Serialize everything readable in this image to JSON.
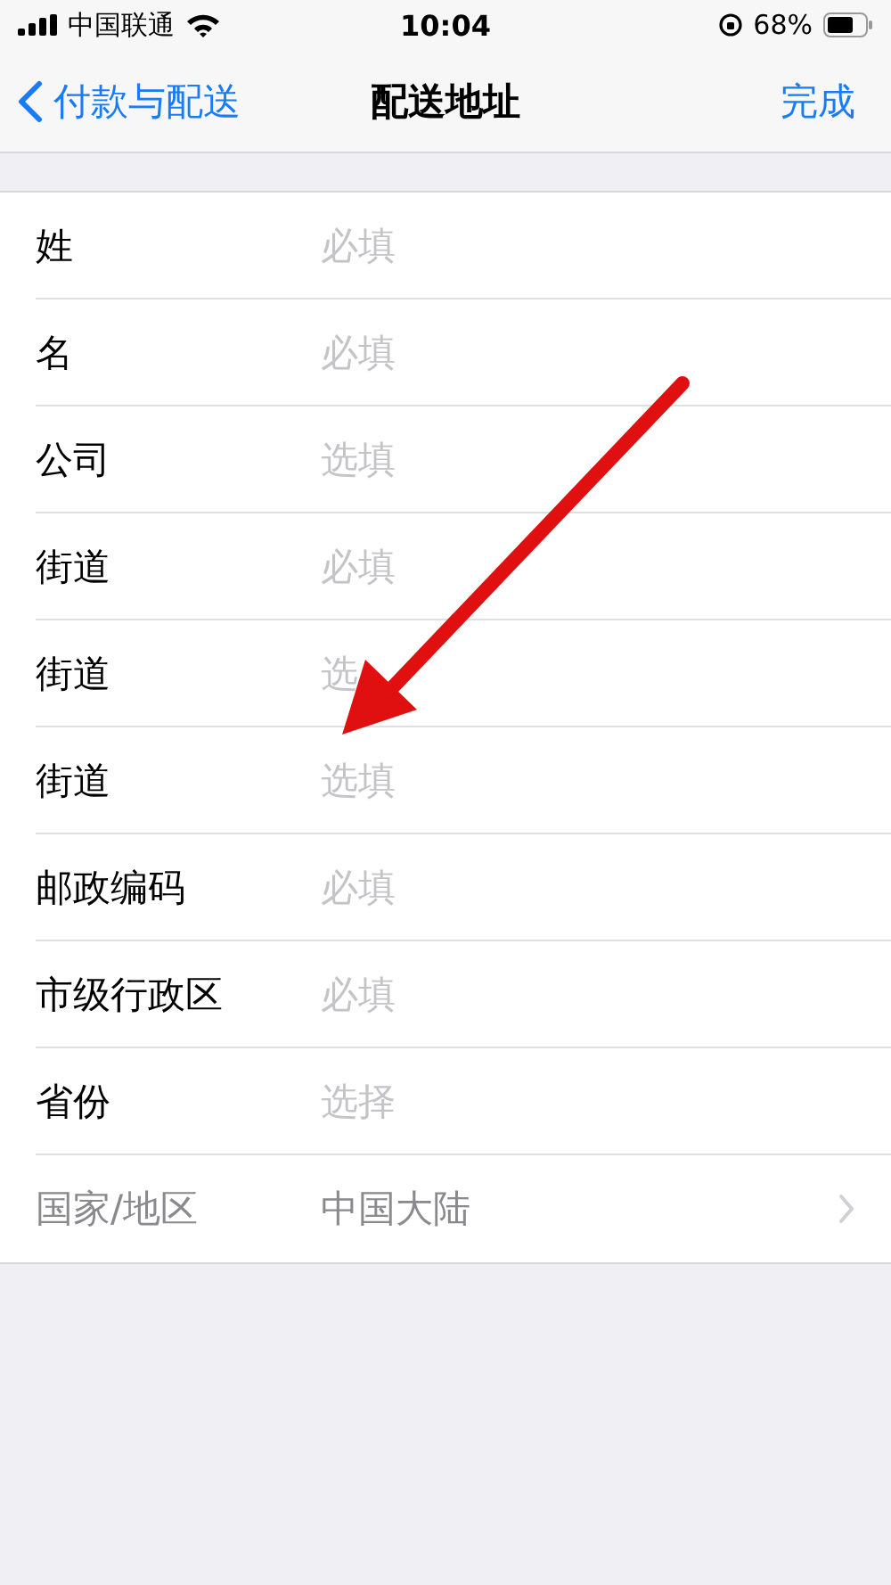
{
  "status_bar": {
    "carrier": "中国联通",
    "time": "10:04",
    "battery": "68%"
  },
  "nav": {
    "back": "付款与配送",
    "title": "配送地址",
    "done": "完成"
  },
  "fields": [
    {
      "kind": "input",
      "label": "姓",
      "placeholder": "必填",
      "disabled": false
    },
    {
      "kind": "input",
      "label": "名",
      "placeholder": "必填",
      "disabled": false
    },
    {
      "kind": "input",
      "label": "公司",
      "placeholder": "选填",
      "disabled": false
    },
    {
      "kind": "input",
      "label": "街道",
      "placeholder": "必填",
      "disabled": false
    },
    {
      "kind": "input",
      "label": "街道",
      "placeholder": "选",
      "disabled": false
    },
    {
      "kind": "input",
      "label": "街道",
      "placeholder": "选填",
      "disabled": false
    },
    {
      "kind": "input",
      "label": "邮政编码",
      "placeholder": "必填",
      "disabled": false
    },
    {
      "kind": "input",
      "label": "市级行政区",
      "placeholder": "必填",
      "disabled": false
    },
    {
      "kind": "input",
      "label": "省份",
      "placeholder": "选择",
      "disabled": false
    },
    {
      "kind": "picker",
      "label": "国家/地区",
      "value": "中国大陆",
      "disabled": true
    }
  ]
}
